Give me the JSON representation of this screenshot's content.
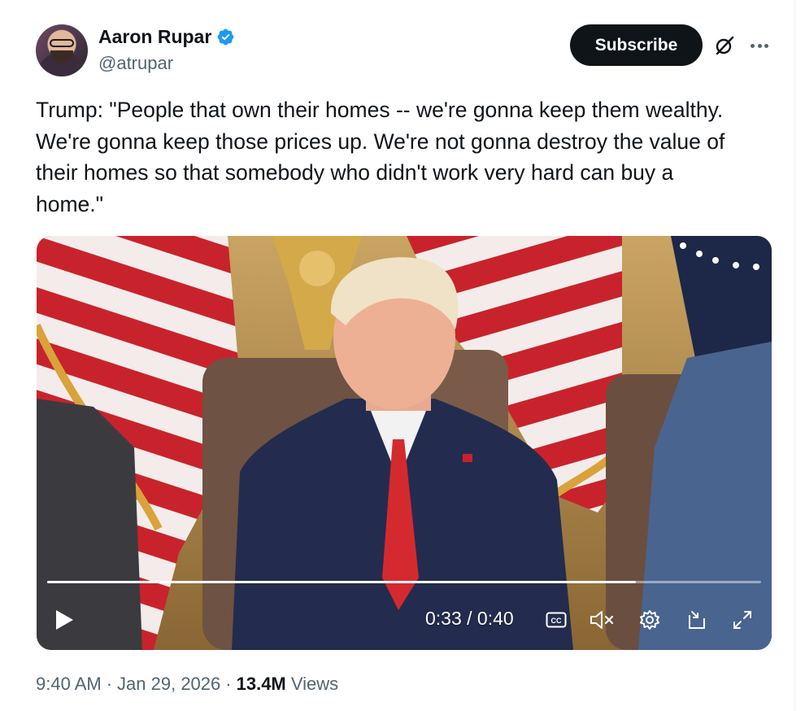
{
  "author": {
    "name": "Aaron Rupar",
    "handle": "@atrupar",
    "verified": true,
    "verified_color": "#1d9bf0"
  },
  "actions": {
    "subscribe_label": "Subscribe",
    "grok_icon": "grok-icon",
    "more_icon": "more-icon"
  },
  "tweet": {
    "text": "Trump: \"People that own their homes -- we're gonna keep them wealthy.\nWe're gonna keep those prices up. We're not gonna destroy the value of\ntheir homes so that somebody who didn't work very hard can buy a\nhome.\""
  },
  "video": {
    "current_time": "0:33",
    "duration": "0:40",
    "time_display": "0:33 / 0:40",
    "progress_fraction": 0.825,
    "controls": [
      "play-icon",
      "cc-icon",
      "mute-icon",
      "settings-icon",
      "pip-icon",
      "fullscreen-icon"
    ]
  },
  "meta": {
    "time": "9:40 AM",
    "separator1": "·",
    "date": "Jan 29, 2026",
    "separator2": "·",
    "views_count": "13.4M",
    "views_label": "Views"
  },
  "colors": {
    "text_primary": "#0f1419",
    "text_secondary": "#536471",
    "button_bg": "#0f1419",
    "brand_blue": "#1d9bf0"
  }
}
